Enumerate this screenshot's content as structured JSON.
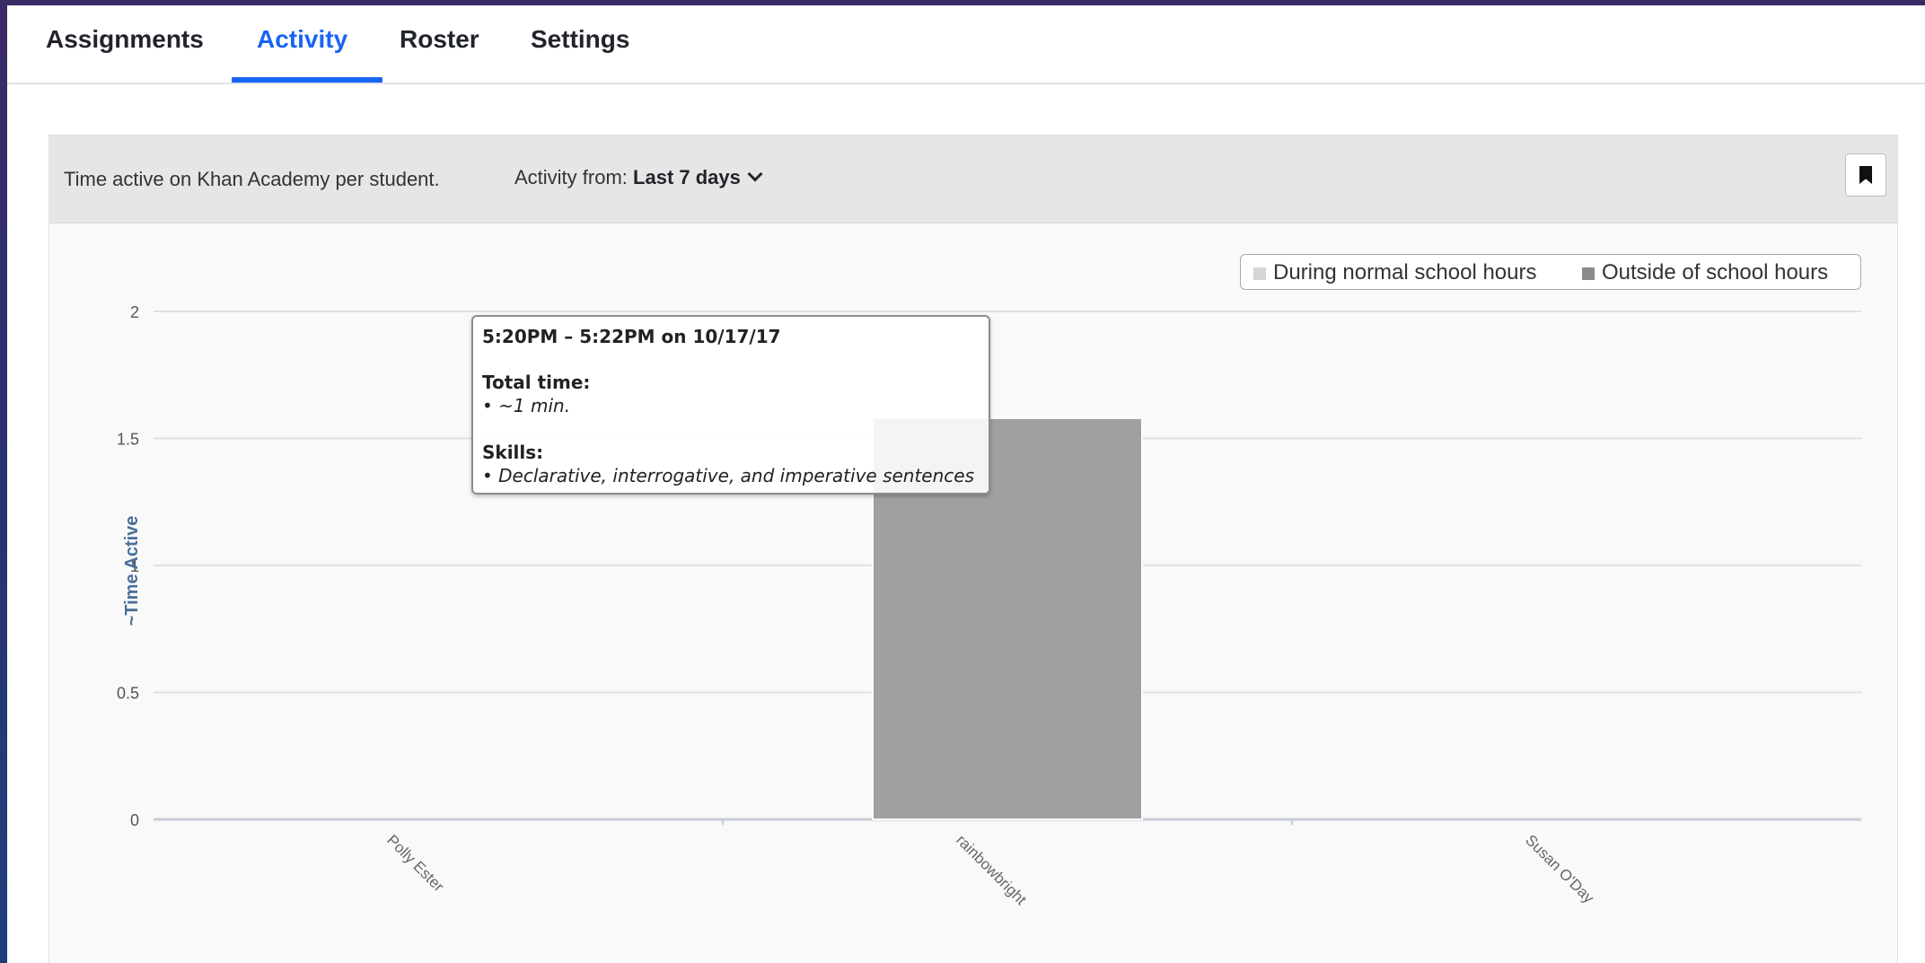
{
  "tabs": [
    {
      "label": "Assignments",
      "active": false
    },
    {
      "label": "Activity",
      "active": true
    },
    {
      "label": "Roster",
      "active": false
    },
    {
      "label": "Settings",
      "active": false
    }
  ],
  "panel": {
    "description": "Time active on Khan Academy per student.",
    "activity_from_label": "Activity from:",
    "activity_from_value": "Last 7 days",
    "bookmark_icon": "bookmark-icon"
  },
  "legend": {
    "during": "During normal school hours",
    "outside": "Outside of school hours",
    "during_color": "#d6d6d6",
    "outside_color": "#8a8a8a"
  },
  "tooltip": {
    "range": "5:20PM – 5:22PM on 10/17/17",
    "total_time_label": "Total time:",
    "total_time_value": "• ~1 min.",
    "skills_label": "Skills:",
    "skills_value": "• Declarative, interrogative, and imperative sentences"
  },
  "chart_data": {
    "type": "bar",
    "categories": [
      "Polly Ester",
      "rainbowbright",
      "Susan O'Day"
    ],
    "series": [
      {
        "name": "During normal school hours",
        "values": [
          0,
          0,
          0
        ],
        "color": "#d6d6d6"
      },
      {
        "name": "Outside of school hours",
        "values": [
          0,
          1.58,
          0
        ],
        "color": "#a0a0a0"
      }
    ],
    "ylabel": "~Time Active",
    "ylim": [
      0,
      2
    ],
    "yticks": [
      0,
      0.5,
      1,
      1.5,
      2
    ],
    "ytick_labels": [
      "0",
      "0.5",
      "1",
      "1.5",
      "2"
    ],
    "grid": true,
    "legend_position": "top-right"
  }
}
